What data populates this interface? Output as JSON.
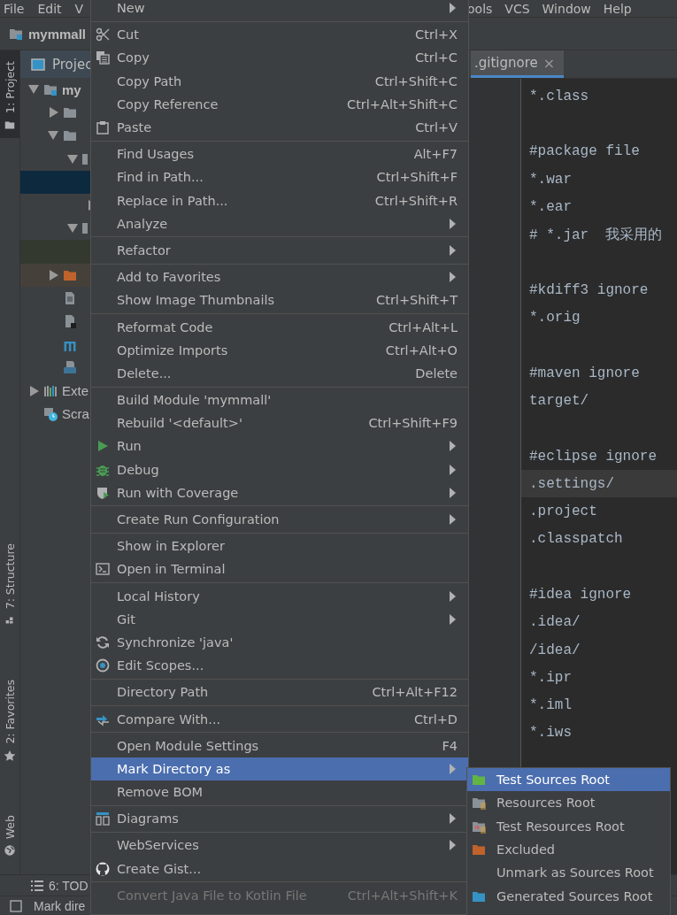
{
  "menubar": {
    "left": [
      {
        "label": "File"
      },
      {
        "label": "Edit"
      },
      {
        "label": "V"
      }
    ],
    "right": [
      {
        "label": "ools"
      },
      {
        "label": "VCS"
      },
      {
        "label": "Window"
      },
      {
        "label": "Help"
      }
    ]
  },
  "navbar": {
    "project": "mymmall"
  },
  "tool_strip": {
    "top": [
      {
        "label": "1: Project",
        "selected": true
      }
    ],
    "bottom": [
      {
        "label": "7: Structure",
        "selected": false
      },
      {
        "label": "2: Favorites",
        "selected": false
      },
      {
        "label": "Web",
        "selected": false
      }
    ]
  },
  "project_panel": {
    "title": "Projec",
    "tree": [
      {
        "label": "my",
        "kind": "module",
        "expanded": true,
        "selected": false,
        "children": [
          {
            "kind": "folder",
            "expanded": false,
            "selected": false
          },
          {
            "kind": "folder",
            "expanded": true,
            "selected": false,
            "children": [
              {
                "kind": "folder-edge",
                "expanded": true,
                "selected": false,
                "children": [
                  {
                    "kind": "hidden",
                    "selected": true
                  },
                  {
                    "kind": "hidden",
                    "expanded": false,
                    "selected": false
                  }
                ]
              },
              {
                "kind": "folder-edge",
                "expanded": true,
                "selected": false,
                "children": [
                  {
                    "kind": "test-folder",
                    "selected": false
                  }
                ]
              }
            ]
          },
          {
            "kind": "excluded-folder",
            "expanded": false,
            "selected": false
          },
          {
            "kind": "file",
            "selected": false
          },
          {
            "kind": "script-file",
            "selected": false
          },
          {
            "kind": "maven",
            "selected": false
          },
          {
            "kind": "markdown",
            "selected": false
          }
        ]
      },
      {
        "label": "Exte",
        "kind": "libraries",
        "expanded": false,
        "selected": false
      },
      {
        "label": "Scra",
        "kind": "scratches",
        "selected": false
      }
    ]
  },
  "editor": {
    "tab": {
      "label": ".gitignore",
      "close": "×",
      "selected": true
    },
    "blocks": [
      [
        {
          "text": "*.class",
          "current": false
        }
      ],
      [
        {
          "text": "#package file",
          "current": false
        },
        {
          "text": "*.war",
          "current": false
        },
        {
          "text": "*.ear",
          "current": false
        },
        {
          "text": "# *.jar  我采用的",
          "current": false
        }
      ],
      [
        {
          "text": "#kdiff3 ignore",
          "current": false
        },
        {
          "text": "*.orig",
          "current": false
        }
      ],
      [
        {
          "text": "#maven ignore",
          "current": false
        },
        {
          "text": "target/",
          "current": false
        }
      ],
      [
        {
          "text": "#eclipse ignore",
          "current": false
        },
        {
          "text": ".settings/",
          "current": true
        },
        {
          "text": ".project",
          "current": false
        },
        {
          "text": ".classpatch",
          "current": false
        }
      ],
      [
        {
          "text": "#idea ignore",
          "current": false
        },
        {
          "text": ".idea/",
          "current": false
        },
        {
          "text": "/idea/",
          "current": false
        },
        {
          "text": "*.ipr",
          "current": false
        },
        {
          "text": "*.iml",
          "current": false
        },
        {
          "text": "*.iws",
          "current": false
        }
      ]
    ]
  },
  "bottom_bar": {
    "tool": "6: TOD"
  },
  "status_bar": {
    "text": "Mark dire"
  },
  "context_menu": [
    [
      {
        "label": "New",
        "submenu": true,
        "selected": false,
        "disabled": false
      }
    ],
    [
      {
        "label": "Cut",
        "shortcut": "Ctrl+X",
        "submenu": false,
        "selected": false,
        "disabled": false
      },
      {
        "label": "Copy",
        "shortcut": "Ctrl+C",
        "submenu": false,
        "selected": false,
        "disabled": false
      },
      {
        "label": "Copy Path",
        "shortcut": "Ctrl+Shift+C",
        "submenu": false,
        "selected": false,
        "disabled": false
      },
      {
        "label": "Copy Reference",
        "shortcut": "Ctrl+Alt+Shift+C",
        "submenu": false,
        "selected": false,
        "disabled": false
      },
      {
        "label": "Paste",
        "shortcut": "Ctrl+V",
        "submenu": false,
        "selected": false,
        "disabled": false
      }
    ],
    [
      {
        "label": "Find Usages",
        "shortcut": "Alt+F7",
        "submenu": false,
        "selected": false,
        "disabled": false
      },
      {
        "label": "Find in Path...",
        "shortcut": "Ctrl+Shift+F",
        "submenu": false,
        "selected": false,
        "disabled": false
      },
      {
        "label": "Replace in Path...",
        "shortcut": "Ctrl+Shift+R",
        "submenu": false,
        "selected": false,
        "disabled": false
      },
      {
        "label": "Analyze",
        "submenu": true,
        "selected": false,
        "disabled": false
      }
    ],
    [
      {
        "label": "Refactor",
        "submenu": true,
        "selected": false,
        "disabled": false
      }
    ],
    [
      {
        "label": "Add to Favorites",
        "submenu": true,
        "selected": false,
        "disabled": false
      },
      {
        "label": "Show Image Thumbnails",
        "shortcut": "Ctrl+Shift+T",
        "submenu": false,
        "selected": false,
        "disabled": false
      }
    ],
    [
      {
        "label": "Reformat Code",
        "shortcut": "Ctrl+Alt+L",
        "submenu": false,
        "selected": false,
        "disabled": false
      },
      {
        "label": "Optimize Imports",
        "shortcut": "Ctrl+Alt+O",
        "submenu": false,
        "selected": false,
        "disabled": false
      },
      {
        "label": "Delete...",
        "shortcut": "Delete",
        "submenu": false,
        "selected": false,
        "disabled": false
      }
    ],
    [
      {
        "label": "Build Module 'mymmall'",
        "submenu": false,
        "selected": false,
        "disabled": false
      },
      {
        "label": "Rebuild '<default>'",
        "shortcut": "Ctrl+Shift+F9",
        "submenu": false,
        "selected": false,
        "disabled": false
      },
      {
        "label": "Run",
        "submenu": true,
        "selected": false,
        "disabled": false
      },
      {
        "label": "Debug",
        "submenu": true,
        "selected": false,
        "disabled": false
      },
      {
        "label": "Run with Coverage",
        "submenu": true,
        "selected": false,
        "disabled": false
      }
    ],
    [
      {
        "label": "Create Run Configuration",
        "submenu": true,
        "selected": false,
        "disabled": false
      }
    ],
    [
      {
        "label": "Show in Explorer",
        "submenu": false,
        "selected": false,
        "disabled": false
      },
      {
        "label": "Open in Terminal",
        "submenu": false,
        "selected": false,
        "disabled": false
      }
    ],
    [
      {
        "label": "Local History",
        "submenu": true,
        "selected": false,
        "disabled": false
      },
      {
        "label": "Git",
        "submenu": true,
        "selected": false,
        "disabled": false
      },
      {
        "label": "Synchronize 'java'",
        "submenu": false,
        "selected": false,
        "disabled": false
      },
      {
        "label": "Edit Scopes...",
        "submenu": false,
        "selected": false,
        "disabled": false
      }
    ],
    [
      {
        "label": "Directory Path",
        "shortcut": "Ctrl+Alt+F12",
        "submenu": false,
        "selected": false,
        "disabled": false
      }
    ],
    [
      {
        "label": "Compare With...",
        "shortcut": "Ctrl+D",
        "submenu": false,
        "selected": false,
        "disabled": false
      }
    ],
    [
      {
        "label": "Open Module Settings",
        "shortcut": "F4",
        "submenu": false,
        "selected": false,
        "disabled": false
      },
      {
        "label": "Mark Directory as",
        "submenu": true,
        "selected": true,
        "disabled": false
      },
      {
        "label": "Remove BOM",
        "submenu": false,
        "selected": false,
        "disabled": false
      }
    ],
    [
      {
        "label": "Diagrams",
        "submenu": true,
        "selected": false,
        "disabled": false
      }
    ],
    [
      {
        "label": "WebServices",
        "submenu": true,
        "selected": false,
        "disabled": false
      },
      {
        "label": "Create Gist...",
        "submenu": false,
        "selected": false,
        "disabled": false
      }
    ],
    [
      {
        "label": "Convert Java File to Kotlin File",
        "shortcut": "Ctrl+Alt+Shift+K",
        "submenu": false,
        "selected": false,
        "disabled": true
      }
    ]
  ],
  "submenu": [
    {
      "label": "Test Sources Root",
      "kind": "test-sources",
      "selected": true
    },
    {
      "label": "Resources Root",
      "kind": "resources",
      "selected": false
    },
    {
      "label": "Test Resources Root",
      "kind": "test-resources",
      "selected": false
    },
    {
      "label": "Excluded",
      "kind": "excluded",
      "selected": false
    },
    {
      "label": "Unmark as Sources Root",
      "kind": "unmark",
      "selected": false
    },
    {
      "label": "Generated Sources Root",
      "kind": "generated",
      "selected": false
    }
  ]
}
